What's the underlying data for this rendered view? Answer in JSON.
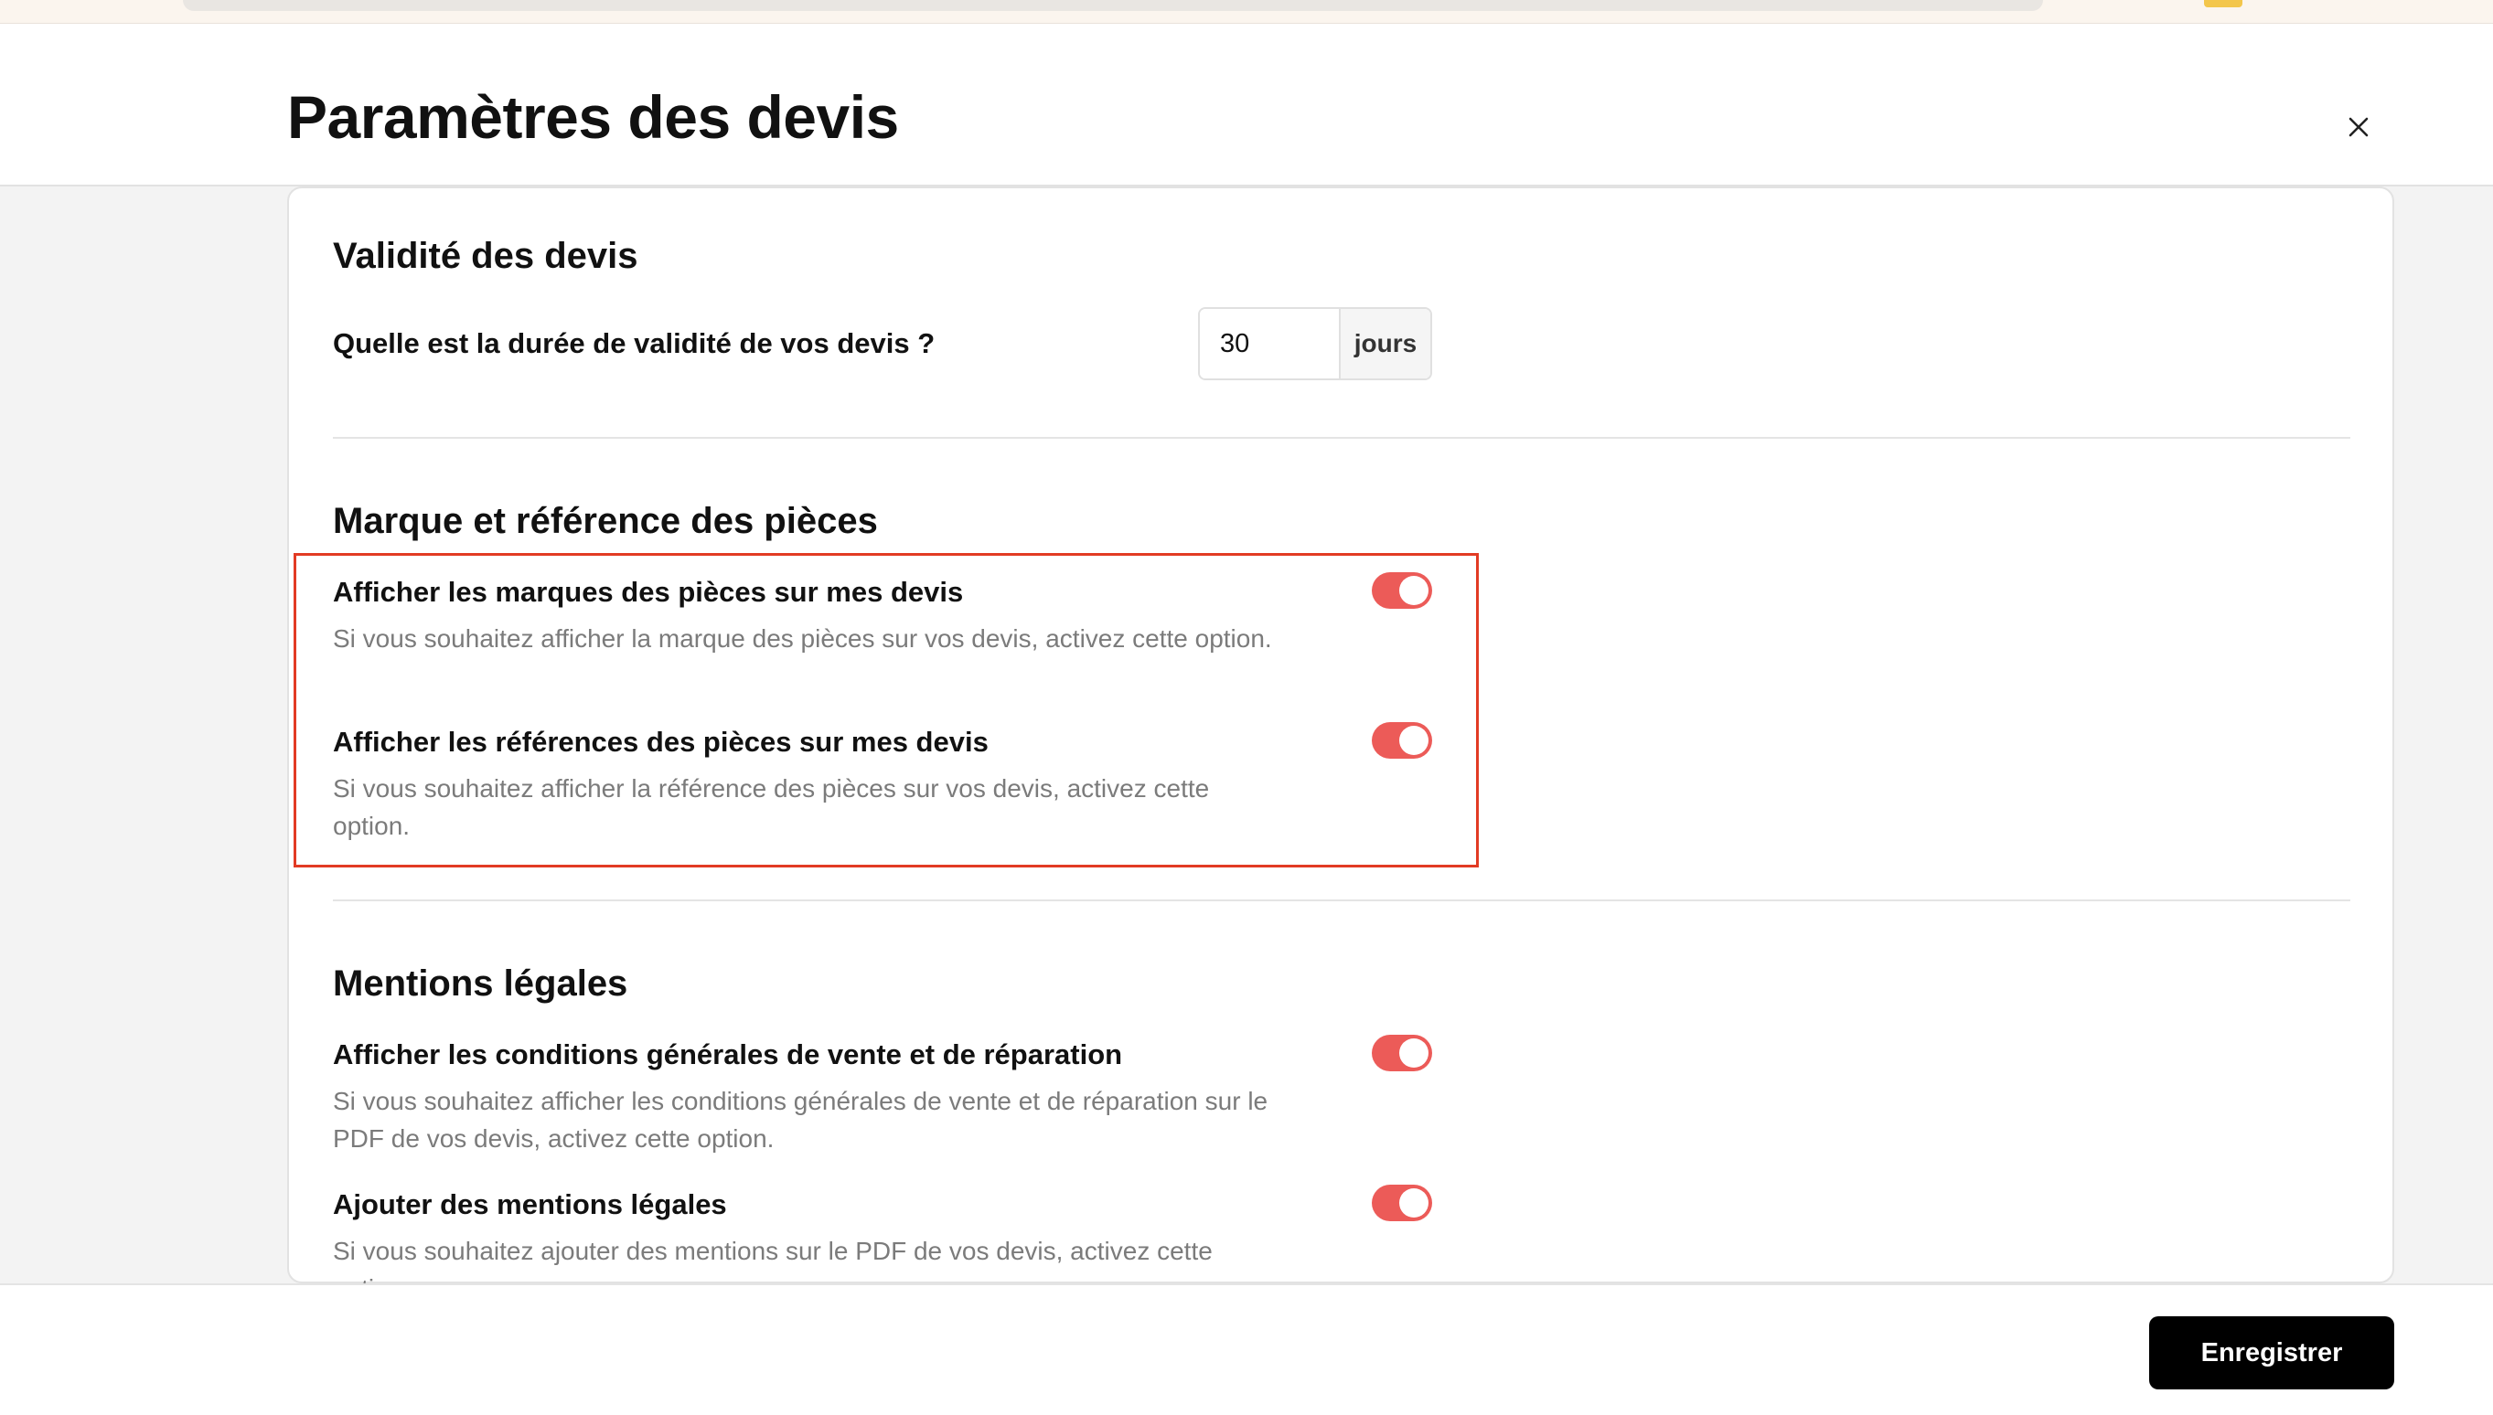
{
  "modal": {
    "title": "Paramètres des devis"
  },
  "validity": {
    "section_title": "Validité des devis",
    "question": "Quelle est la durée de validité de vos devis ?",
    "value": "30",
    "unit": "jours"
  },
  "parts": {
    "section_title": "Marque et référence des pièces",
    "options": [
      {
        "label": "Afficher les marques des pièces sur mes devis",
        "description": "Si vous souhaitez afficher la marque des pièces sur vos devis, activez cette option.",
        "enabled": true
      },
      {
        "label": "Afficher les références des pièces sur mes devis",
        "description": "Si vous souhaitez afficher la référence des pièces sur vos devis, activez cette option.",
        "enabled": true
      }
    ]
  },
  "legal": {
    "section_title": "Mentions légales",
    "options": [
      {
        "label": "Afficher les conditions générales de vente et de réparation",
        "description": "Si vous souhaitez afficher les conditions générales de vente et de réparation sur le PDF de vos devis, activez cette option.",
        "enabled": true
      },
      {
        "label": "Ajouter des mentions légales",
        "description": "Si vous souhaitez ajouter des mentions sur le PDF de vos devis, activez cette option.",
        "enabled": true
      }
    ]
  },
  "footer": {
    "save_label": "Enregistrer"
  },
  "colors": {
    "toggle_on": "#ec5b58",
    "highlight_border": "#e23b24",
    "primary_button": "#000000"
  }
}
